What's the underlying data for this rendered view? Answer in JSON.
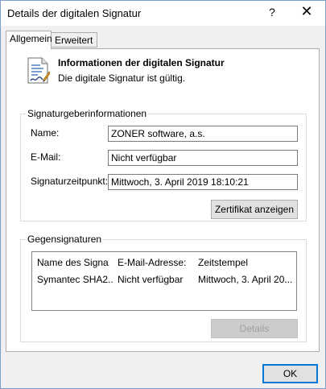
{
  "window": {
    "title": "Details der digitalen Signatur",
    "help_label": "?",
    "close_label": "✕"
  },
  "tabs": [
    {
      "label": "Allgemein",
      "active": true
    },
    {
      "label": "Erweitert",
      "active": false
    }
  ],
  "header": {
    "icon": "signed-document-icon",
    "title": "Informationen der digitalen Signatur",
    "status": "Die digitale Signatur ist gültig."
  },
  "signer": {
    "group_title": "Signaturgeberinformationen",
    "name_label": "Name:",
    "name_value": "ZONER software, a.s.",
    "email_label": "E-Mail:",
    "email_value": "Nicht verfügbar",
    "time_label": "Signaturzeitpunkt:",
    "time_value": "Mittwoch, 3. April 2019 18:10:21",
    "cert_button": "Zertifikat anzeigen"
  },
  "countersignatures": {
    "group_title": "Gegensignaturen",
    "columns": [
      "Name des Signa...",
      "E-Mail-Adresse:",
      "Zeitstempel"
    ],
    "rows": [
      [
        "Symantec SHA2...",
        "Nicht verfügbar",
        "Mittwoch, 3. April 20..."
      ]
    ],
    "details_button": "Details"
  },
  "footer": {
    "ok_button": "OK"
  }
}
